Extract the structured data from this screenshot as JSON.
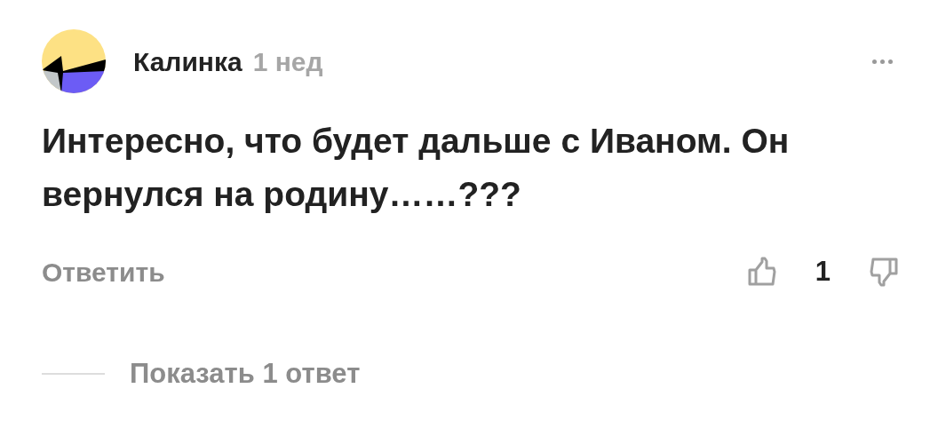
{
  "comment": {
    "author": "Калинка",
    "time": "1 нед",
    "text": "Интересно, что будет дальше с Иваном. Он вернулся на родину……???"
  },
  "actions": {
    "reply": "Ответить",
    "likes": "1"
  },
  "replies_toggle": "Показать 1 ответ"
}
